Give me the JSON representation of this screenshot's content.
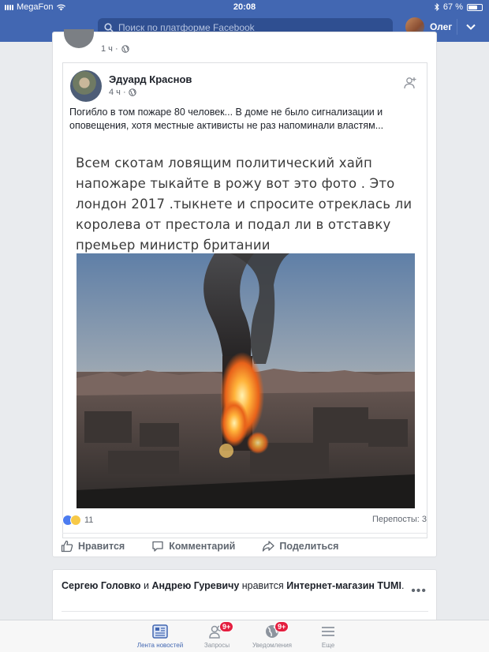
{
  "status_bar": {
    "carrier": "MegaFon",
    "time": "20:08",
    "battery": "67 %"
  },
  "header": {
    "search_placeholder": "Поиск по платформе Facebook",
    "user_name": "Олег"
  },
  "prev_post": {
    "time": "1 ч ·"
  },
  "post": {
    "author": "Эдуард Краснов",
    "time": "4 ч ·",
    "text": "Погибло в том пожаре 80 человек... В доме не было сигнализации и оповещения, хотя местные активисты не раз напоминали властям...",
    "image_caption": "Всем скотам ловящим политический хайп напожаре тыкайте в рожу вот это фото . Это лондон 2017 .тыкнете и спросите отреклась ли королева от престола и подал ли в отставку премьер министр британии",
    "reactions_count": "11",
    "shares": "Перепосты: 3",
    "actions": {
      "like": "Нравится",
      "comment": "Комментарий",
      "share": "Поделиться"
    }
  },
  "next_post": {
    "friend1": "Сергею Головко",
    "and": " и ",
    "friend2": "Андрею Гуревичу",
    "likes_text": " нравится ",
    "page": "Интернет-магазин TUMI",
    "dot": ".",
    "more": "•••"
  },
  "tabs": [
    {
      "label": "Лента новостей",
      "icon": "news-feed-icon",
      "badge": ""
    },
    {
      "label": "Запросы",
      "icon": "friend-requests-icon",
      "badge": "9+"
    },
    {
      "label": "Уведомления",
      "icon": "globe-icon",
      "badge": "9+"
    },
    {
      "label": "Еще",
      "icon": "menu-icon",
      "badge": ""
    }
  ],
  "colors": {
    "brand": "#4267b2",
    "badge": "#e41e3f",
    "background": "#e9ebee"
  }
}
